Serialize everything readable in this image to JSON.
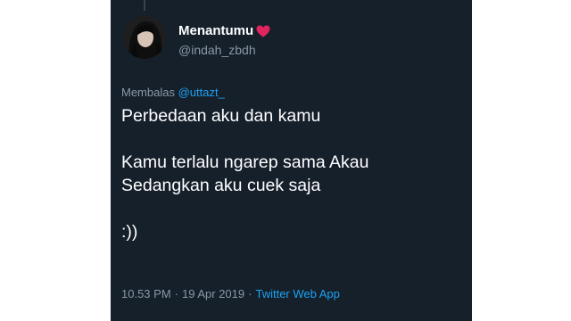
{
  "colors": {
    "background": "#15202b",
    "text": "#ffffff",
    "secondary_text": "#8899a6",
    "link": "#1da1f2",
    "heart": "#e0245e"
  },
  "author": {
    "display_name": "Menantumu",
    "handle": "@indah_zbdh",
    "name_suffix_icon": "red-heart-icon"
  },
  "reply": {
    "prefix": "Membalas",
    "mention": "@uttazt_"
  },
  "tweet": {
    "line_1": "Perbedaan aku dan kamu",
    "line_2": "Kamu terlalu ngarep sama Akau\nSedangkan aku cuek saja",
    "line_3": ":))"
  },
  "meta": {
    "time": "10.53 PM",
    "separator_1": "·",
    "date": "19 Apr 2019",
    "separator_2": "·",
    "source": "Twitter Web App"
  }
}
